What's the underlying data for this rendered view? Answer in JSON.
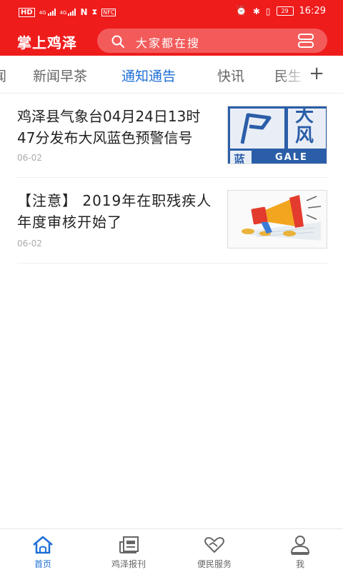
{
  "status": {
    "left": [
      "HD",
      "4G",
      "4G",
      "N",
      "NFC"
    ],
    "battery": "29",
    "time": "16:29"
  },
  "header": {
    "app_name": "掌上鸡泽",
    "search_placeholder": "大家都在搜",
    "accent": "#ef1c1c"
  },
  "tabs": [
    {
      "label": "闻"
    },
    {
      "label": "新闻早茶"
    },
    {
      "label": "通知通告",
      "active": true
    },
    {
      "label": "快讯"
    },
    {
      "label": "民生"
    }
  ],
  "tabs_more": "+",
  "news": [
    {
      "title": "鸡泽县气象台04月24日13时47分发布大风蓝色预警信号",
      "date": "06-02",
      "thumb": {
        "big": "大",
        "wind": "风",
        "color": "蓝",
        "label": "GALE"
      }
    },
    {
      "title": "【注意】 2019年在职残疾人年度审核开始了",
      "date": "06-02",
      "thumb": {
        "icon": "megaphone-icon"
      }
    }
  ],
  "bottom_nav": [
    {
      "label": "首页",
      "icon": "home-icon",
      "active": true
    },
    {
      "label": "鸡泽报刊",
      "icon": "newspaper-icon"
    },
    {
      "label": "便民服务",
      "icon": "heart-hands-icon"
    },
    {
      "label": "我",
      "icon": "user-icon"
    }
  ]
}
